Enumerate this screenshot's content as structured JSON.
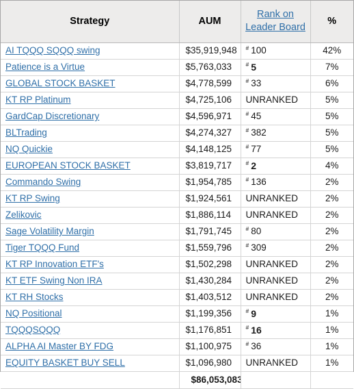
{
  "table": {
    "columns": [
      {
        "key": "strategy",
        "label": "Strategy",
        "is_link": false
      },
      {
        "key": "aum",
        "label": "AUM",
        "is_link": false
      },
      {
        "key": "rank",
        "label": "Rank on Leader Board",
        "is_link": true
      },
      {
        "key": "pct",
        "label": "%",
        "is_link": false
      }
    ],
    "header_link_color": "#2f6fa8",
    "header_background": "#edeceb",
    "link_color": "#2f6fa8",
    "rows": [
      {
        "strategy": "AI TQQQ SQQQ swing",
        "aum": "$35,919,948",
        "rank_prefix": "#",
        "rank": "100",
        "rank_bold": false,
        "ranked": true,
        "pct": "42%"
      },
      {
        "strategy": "Patience is a Virtue",
        "aum": "$5,763,033",
        "rank_prefix": "#",
        "rank": "5",
        "rank_bold": true,
        "ranked": true,
        "pct": "7%"
      },
      {
        "strategy": "GLOBAL STOCK BASKET",
        "aum": "$4,778,599",
        "rank_prefix": "#",
        "rank": "33",
        "rank_bold": false,
        "ranked": true,
        "pct": "6%"
      },
      {
        "strategy": "KT RP Platinum",
        "aum": "$4,725,106",
        "rank_prefix": "",
        "rank": "UNRANKED",
        "rank_bold": false,
        "ranked": false,
        "pct": "5%"
      },
      {
        "strategy": "GardCap Discretionary",
        "aum": "$4,596,971",
        "rank_prefix": "#",
        "rank": "45",
        "rank_bold": false,
        "ranked": true,
        "pct": "5%"
      },
      {
        "strategy": "BLTrading",
        "aum": "$4,274,327",
        "rank_prefix": "#",
        "rank": "382",
        "rank_bold": false,
        "ranked": true,
        "pct": "5%"
      },
      {
        "strategy": "NQ Quickie",
        "aum": "$4,148,125",
        "rank_prefix": "#",
        "rank": "77",
        "rank_bold": false,
        "ranked": true,
        "pct": "5%"
      },
      {
        "strategy": "EUROPEAN STOCK BASKET",
        "aum": "$3,819,717",
        "rank_prefix": "#",
        "rank": "2",
        "rank_bold": true,
        "ranked": true,
        "pct": "4%"
      },
      {
        "strategy": "Commando Swing",
        "aum": "$1,954,785",
        "rank_prefix": "#",
        "rank": "136",
        "rank_bold": false,
        "ranked": true,
        "pct": "2%"
      },
      {
        "strategy": "KT RP Swing",
        "aum": "$1,924,561",
        "rank_prefix": "",
        "rank": "UNRANKED",
        "rank_bold": false,
        "ranked": false,
        "pct": "2%"
      },
      {
        "strategy": "Zelikovic",
        "aum": "$1,886,114",
        "rank_prefix": "",
        "rank": "UNRANKED",
        "rank_bold": false,
        "ranked": false,
        "pct": "2%"
      },
      {
        "strategy": "Sage Volatility Margin",
        "aum": "$1,791,745",
        "rank_prefix": "#",
        "rank": "80",
        "rank_bold": false,
        "ranked": true,
        "pct": "2%"
      },
      {
        "strategy": "Tiger TQQQ Fund",
        "aum": "$1,559,796",
        "rank_prefix": "#",
        "rank": "309",
        "rank_bold": false,
        "ranked": true,
        "pct": "2%"
      },
      {
        "strategy": "KT RP Innovation ETF's",
        "aum": "$1,502,298",
        "rank_prefix": "",
        "rank": "UNRANKED",
        "rank_bold": false,
        "ranked": false,
        "pct": "2%"
      },
      {
        "strategy": "KT ETF Swing Non IRA",
        "aum": "$1,430,284",
        "rank_prefix": "",
        "rank": "UNRANKED",
        "rank_bold": false,
        "ranked": false,
        "pct": "2%"
      },
      {
        "strategy": "KT RH Stocks",
        "aum": "$1,403,512",
        "rank_prefix": "",
        "rank": "UNRANKED",
        "rank_bold": false,
        "ranked": false,
        "pct": "2%"
      },
      {
        "strategy": "NQ Positional",
        "aum": "$1,199,356",
        "rank_prefix": "#",
        "rank": "9",
        "rank_bold": true,
        "ranked": true,
        "pct": "1%"
      },
      {
        "strategy": "TQQQSQQQ",
        "aum": "$1,176,851",
        "rank_prefix": "#",
        "rank": "16",
        "rank_bold": true,
        "ranked": true,
        "pct": "1%"
      },
      {
        "strategy": "ALPHA AI Master BY FDG",
        "aum": "$1,100,975",
        "rank_prefix": "#",
        "rank": "36",
        "rank_bold": false,
        "ranked": true,
        "pct": "1%"
      },
      {
        "strategy": "EQUITY BASKET BUY SELL",
        "aum": "$1,096,980",
        "rank_prefix": "",
        "rank": "UNRANKED",
        "rank_bold": false,
        "ranked": false,
        "pct": "1%"
      }
    ],
    "total": {
      "strategy": "",
      "aum": "$86,053,083",
      "rank": "",
      "pct": ""
    }
  }
}
